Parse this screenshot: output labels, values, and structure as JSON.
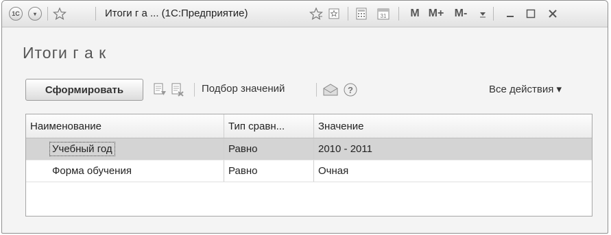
{
  "window": {
    "title": "Итоги г а ...  (1С:Предприятие)",
    "app_icon": "1c-logo-icon",
    "memory_buttons": [
      "M",
      "M+",
      "M-"
    ]
  },
  "form": {
    "title": "Итоги г а к"
  },
  "toolbar": {
    "generate_label": "Сформировать",
    "select_values_label": "Подбор значений",
    "all_actions_label": "Все действия ▾"
  },
  "table": {
    "columns": [
      "Наименование",
      "Тип сравн...",
      "Значение"
    ],
    "rows": [
      {
        "name": "Учебный год",
        "compare": "Равно",
        "value": "2010 - 2011"
      },
      {
        "name": "Форма обучения",
        "compare": "Равно",
        "value": "Очная"
      }
    ]
  },
  "colors": {
    "selected_row": "#d4d4d4",
    "window_bg": "#f4f4f4"
  }
}
